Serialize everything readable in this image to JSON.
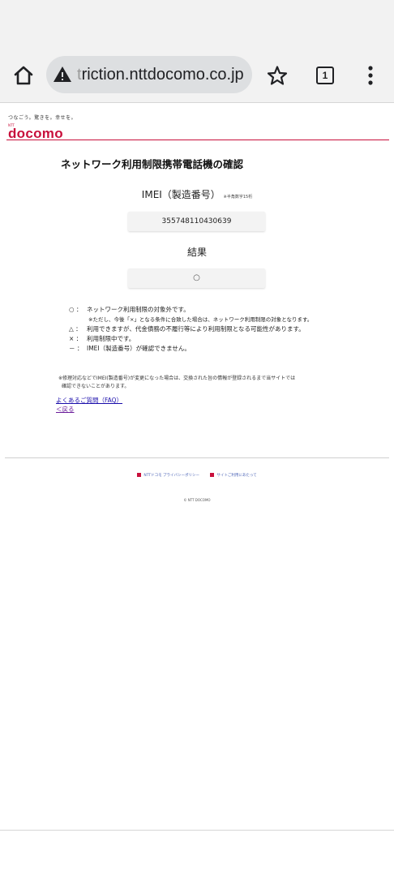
{
  "browser": {
    "url_prefix": "t",
    "url_main": "riction.nttdocomo.co.jp",
    "tab_count": "1"
  },
  "brand": {
    "tagline": "つなごう。驚きを。幸せを。",
    "ntt": "NTT",
    "name": "docomo",
    "color": "#c8103c"
  },
  "page": {
    "title": "ネットワーク利用制限携帯電話機の確認",
    "imei_label": "IMEI（製造番号）",
    "imei_note": "※半角数字15桁",
    "imei_value": "355748110430639",
    "result_label": "結果",
    "result_value": "○"
  },
  "legend": [
    {
      "symbol": "○ ：",
      "text": "ネットワーク利用制限の対象外です。"
    },
    {
      "symbol": "",
      "text": "※ただし、今後「×」となる条件に合致した場合は、ネットワーク利用制限の対象となります。"
    },
    {
      "symbol": "△ ：",
      "text": "利用できますが、代金債務の不履行等により利用制限となる可能性があります。"
    },
    {
      "symbol": "× ：",
      "text": "利用制限中です。"
    },
    {
      "symbol": "－ ：",
      "text": "IMEI（製造番号）が確認できません。"
    }
  ],
  "notice": {
    "line1": "※修理対応などでIMEI(製造番号)が変更になった場合は、交換された旨の情報が登録されるまで当サイトでは",
    "line2": "確認できないことがあります。"
  },
  "links": {
    "faq": "よくあるご質問（FAQ）",
    "back": "＜戻る"
  },
  "footer": {
    "privacy": "NTTドコモ プライバシーポリシー",
    "site_usage": "サイトご利用にあたって",
    "copyright": "© NTT DOCOMO"
  }
}
